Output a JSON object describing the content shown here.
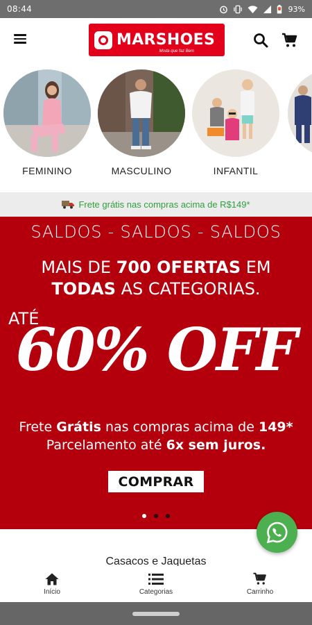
{
  "status_bar": {
    "time": "08:44",
    "battery": "93%",
    "icons": [
      "alarm-icon",
      "vibrate-icon",
      "wifi-icon",
      "signal-icon",
      "battery-icon"
    ]
  },
  "header": {
    "logo_text": "MARSHOES",
    "logo_tagline": "Moda que faz Bem",
    "icons": [
      "menu-icon",
      "search-icon",
      "cart-icon"
    ]
  },
  "categories": [
    {
      "label": "FEMININO"
    },
    {
      "label": "MASCULINO"
    },
    {
      "label": "INFANTIL"
    },
    {
      "label": ""
    }
  ],
  "shipping": {
    "text": "Frete grátis nas compras acima de R$149*",
    "icon": "truck-icon"
  },
  "banner": {
    "saldos": "SALDOS - SALDOS - SALDOS",
    "headline_prefix": "MAIS DE ",
    "headline_bold1": "700 OFERTAS",
    "headline_mid": " EM",
    "headline_bold2": "TODAS",
    "headline_suffix": " AS CATEGORIAS.",
    "ate": "ATÉ",
    "discount": "60% OFF",
    "line1_a": "Frete ",
    "line1_bold": "Grátis",
    "line1_b": " nas compras acima de ",
    "line1_bold2": "149*",
    "line2_a": "Parcelamento até ",
    "line2_bold": "6x sem juros.",
    "button": "COMPRAR",
    "dots": 3,
    "active_dot": 1
  },
  "section_title": "Casacos e Jaquetas",
  "bottom_nav": [
    {
      "label": "Início",
      "icon": "home-icon"
    },
    {
      "label": "Categorias",
      "icon": "list-icon"
    },
    {
      "label": "Carrinho",
      "icon": "cart-icon"
    }
  ],
  "colors": {
    "brand_red": "#e3001b",
    "banner_red": "#b3000c",
    "shipping_green": "#2e9e3e",
    "whatsapp_green": "#4caf50"
  }
}
